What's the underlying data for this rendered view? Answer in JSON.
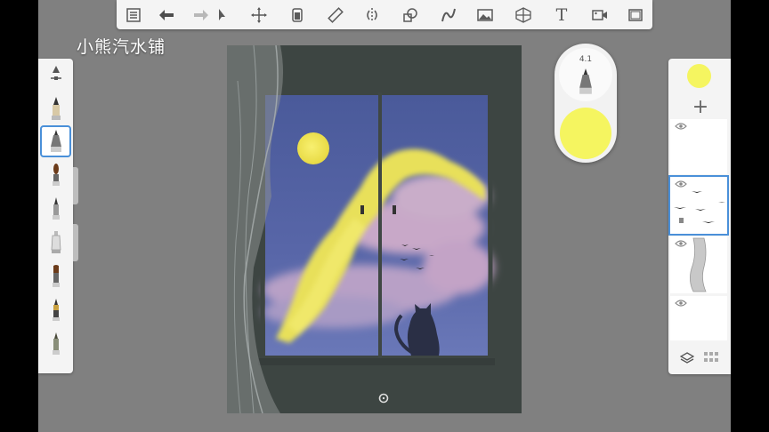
{
  "app": {
    "background": "#808080",
    "accent": "#4a90d9"
  },
  "watermark": "小熊汽水铺",
  "top_toolbar": {
    "tools": [
      {
        "name": "list-icon"
      },
      {
        "name": "undo-icon"
      },
      {
        "name": "redo-icon"
      },
      {
        "name": "select-icon"
      },
      {
        "name": "transform-icon"
      },
      {
        "name": "fill-icon"
      },
      {
        "name": "ruler-icon"
      },
      {
        "name": "symmetry-icon"
      },
      {
        "name": "shape-icon"
      },
      {
        "name": "curve-icon"
      },
      {
        "name": "image-icon"
      },
      {
        "name": "perspective-icon"
      },
      {
        "name": "text-icon",
        "glyph": "T"
      },
      {
        "name": "video-icon"
      },
      {
        "name": "fullscreen-icon"
      }
    ]
  },
  "brush_palette": {
    "brushes": [
      "brush-settings-icon",
      "pencil-brush-icon",
      "marker-brush-icon",
      "paint-brush-icon",
      "ink-brush-icon",
      "airbrush-icon",
      "flat-brush-icon",
      "pen-brush-icon",
      "blender-brush-icon"
    ],
    "selected_index": 2
  },
  "brush_puck": {
    "size": "4.1",
    "color": "#f5f560"
  },
  "layers": {
    "current_color": "#f5f560",
    "add_label": "+",
    "count": 5,
    "selected_index": 1
  },
  "canvas": {
    "home_icon": "reset-view-icon"
  }
}
